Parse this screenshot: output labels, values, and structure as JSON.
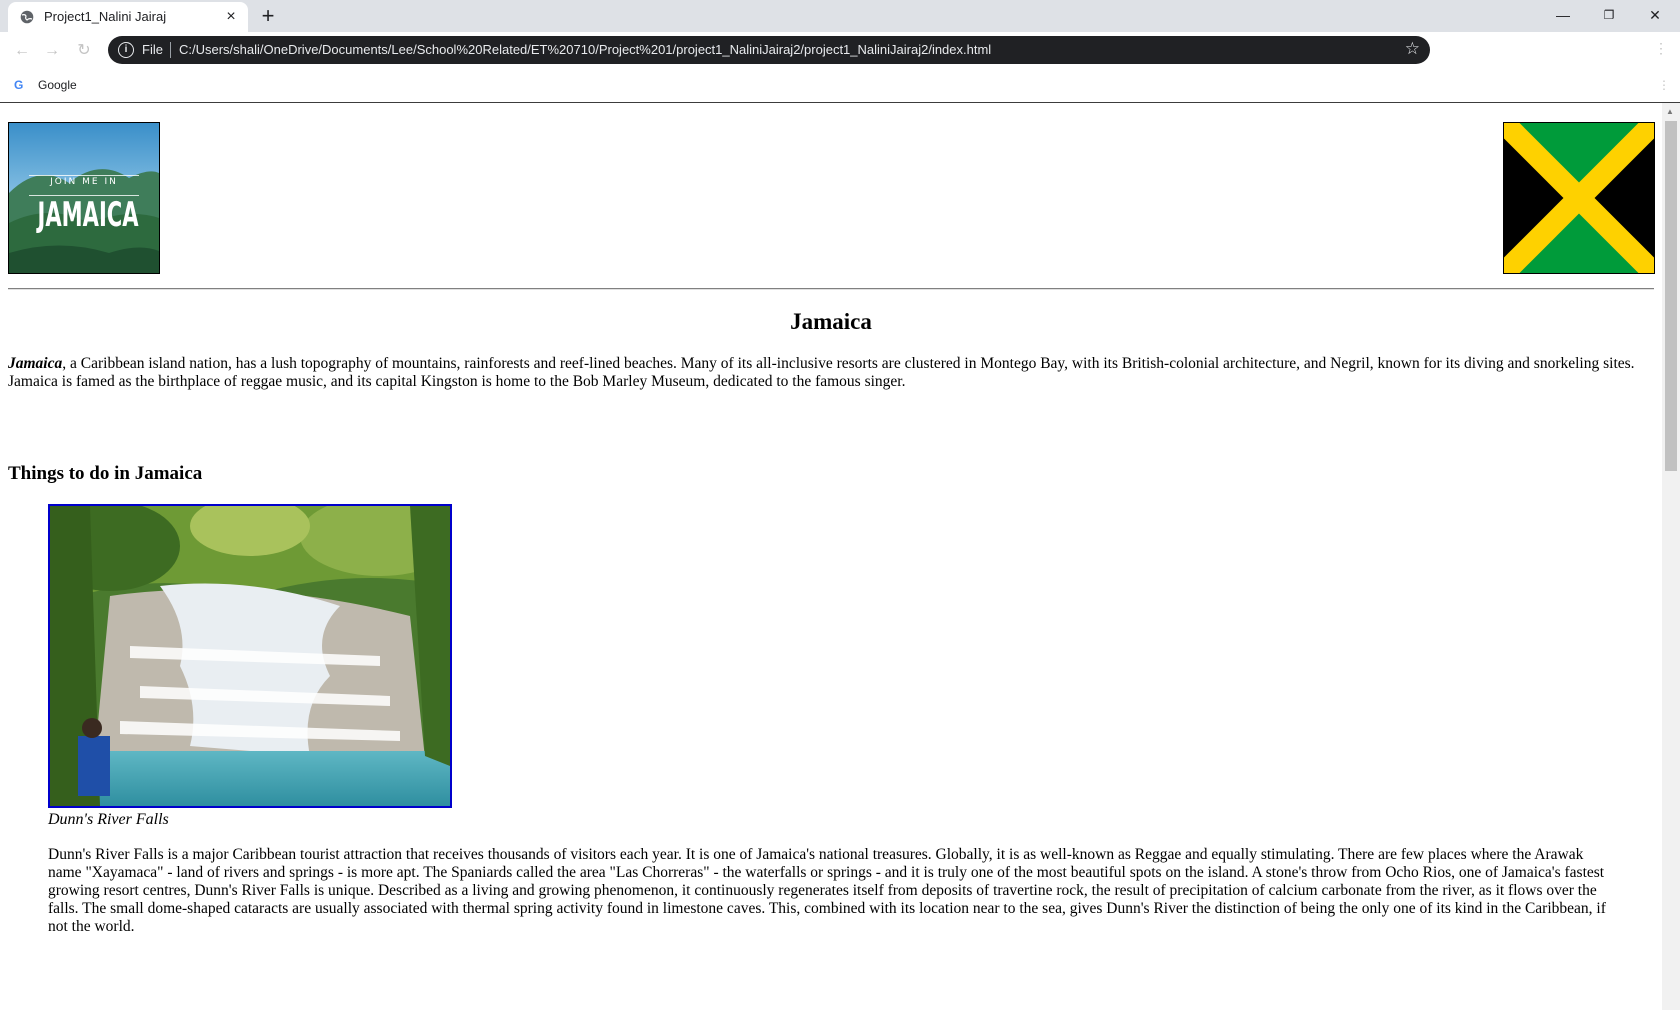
{
  "browser": {
    "tab_title": "Project1_Nalini Jairaj",
    "tab_close_icon": "×",
    "new_tab_icon": "+",
    "minimize_icon": "—",
    "restore_icon": "❐",
    "close_icon": "✕",
    "omnibox": {
      "scheme_label": "File",
      "url": "C:/Users/shali/OneDrive/Documents/Lee/School%20Related/ET%20710/Project%201/project1_NaliniJairaj2/project1_NaliniJairaj2/index.html"
    },
    "bookmarks": [
      {
        "label": "Google"
      }
    ]
  },
  "page": {
    "logo": {
      "line1": "JOIN ME IN",
      "line2": "JAMAICA"
    },
    "heading": "Jamaica",
    "intro_lead": "Jamaica",
    "intro_text": ", a Caribbean island nation, has a lush topography of mountains, rainforests and reef-lined beaches. Many of its all-inclusive resorts are clustered in Montego Bay, with its British-colonial architecture, and Negril, known for its diving and snorkeling sites. Jamaica is famed as the birthplace of reggae music, and its capital Kingston is home to the Bob Marley Museum, dedicated to the famous singer.",
    "things_heading": "Things to do in Jamaica",
    "photo_caption": "Dunn's River Falls",
    "photo_description": "Dunn's River Falls is a major Caribbean tourist attraction that receives thousands of visitors each year. It is one of Jamaica's national treasures. Globally, it is as well-known as Reggae and equally stimulating. There are few places where the Arawak name \"Xayamaca\" - land of rivers and springs - is more apt. The Spaniards called the area \"Las Chorreras\" - the waterfalls or springs - and it is truly one of the most beautiful spots on the island. A stone's throw from Ocho Rios, one of Jamaica's fastest growing resort centres, Dunn's River Falls is unique. Described as a living and growing phenomenon, it continuously regenerates itself from deposits of travertine rock, the result of precipitation of calcium carbonate from the river, as it flows over the falls. The small dome-shaped cataracts are usually associated with thermal spring activity found in limestone caves. This, combined with its location near to the sea, gives Dunn's River the distinction of being the only one of its kind in the Caribbean, if not the world."
  },
  "colors": {
    "flag_green": "#009b3a",
    "flag_gold": "#fed100",
    "flag_black": "#000000",
    "photo_border": "#0000cc"
  }
}
